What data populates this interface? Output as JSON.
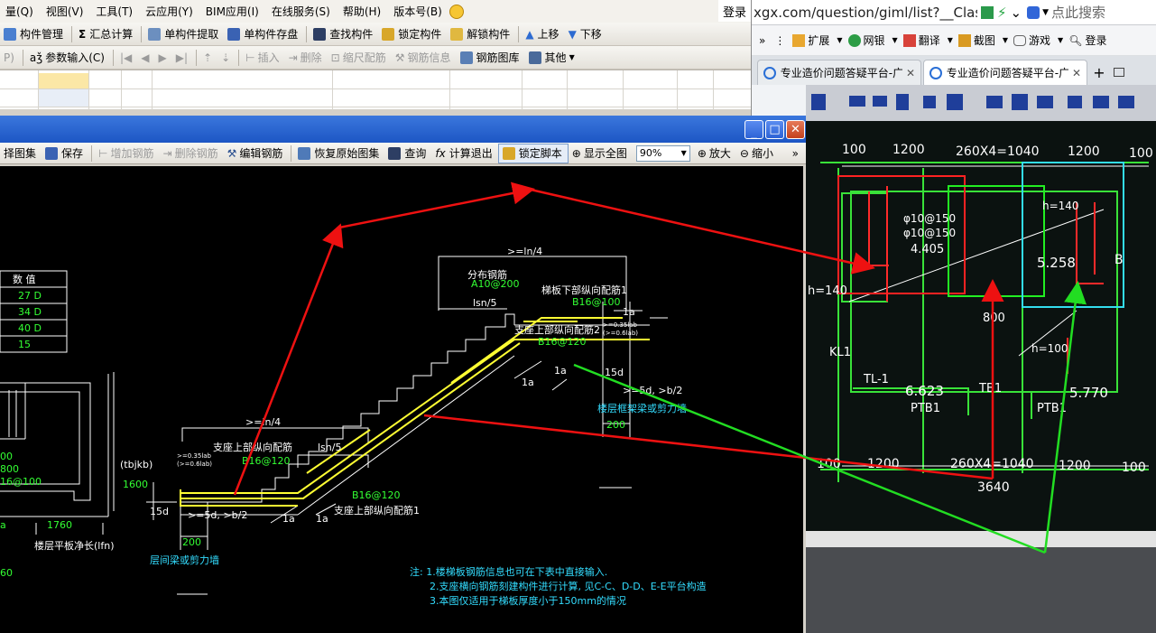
{
  "menu": {
    "items": [
      "量(Q)",
      "视图(V)",
      "工具(T)",
      "云应用(Y)",
      "BIM应用(I)",
      "在线服务(S)",
      "帮助(H)",
      "版本号(B)"
    ],
    "login": "登录"
  },
  "toolbar1": {
    "items": [
      "构件管理",
      "汇总计算",
      "单构件提取",
      "单构件存盘",
      "查找构件",
      "锁定构件",
      "解锁构件",
      "上移",
      "下移"
    ]
  },
  "toolbar2": {
    "prefix": "P)",
    "param_input": "参数输入(C)",
    "insert": "插入",
    "delete": "删除",
    "scale_rebar": "缩尺配筋",
    "rebar_info": "钢筋信息",
    "rebar_library": "钢筋图库",
    "other": "其他"
  },
  "dialog_toolbar": {
    "select_atlas": "择图集",
    "save": "保存",
    "add_rebar": "增加钢筋",
    "delete_rebar": "删除钢筋",
    "edit_rebar": "编辑钢筋",
    "restore_atlas": "恢复原始图集",
    "query": "查询",
    "calc_exit": "计算退出",
    "lock_script": "锁定脚本",
    "show_all": "显示全图",
    "zoom_value": "90%",
    "zoom_in": "放大",
    "zoom_out": "缩小"
  },
  "cad": {
    "table_header": "数 值",
    "table_rows": [
      "27 D",
      "34 D",
      "40 D",
      "15"
    ],
    "left_values": [
      "00",
      "800",
      "16@100"
    ],
    "dim_1760": "1760",
    "dim_a": "a",
    "dim_60": "60",
    "net_length_label": "楼层平板净长(lfn)",
    "tbjkb": "(tbjkb)",
    "dim_1600": "1600",
    "dim_15d_left": "15d",
    "dim_200_left": "200",
    "beam_wall_left": "层间梁或剪力墙",
    "dim_5d_left": ">=5d, >b/2",
    "la_1": "1a",
    "la_2": "1a",
    "support_top_rebar": "支座上部纵向配筋",
    "b16_120_a": "B16@120",
    "ln4_left": ">=ln/4",
    "lsn5_left": "lsn/5",
    "lab_left_1": ">=0.35lab",
    "lab_left_2": "(>=0.6lab)",
    "b16_120_b": "B16@120",
    "support_top_rebar_1": "支座上部纵向配筋1",
    "ln4_right": ">=ln/4",
    "distribution_rebar": "分布钢筋",
    "a10_200": "A10@200",
    "lsn5_right": "lsn/5",
    "bottom_rebar_1": "梯板下部纵向配筋1",
    "b16_100": "B16@100",
    "support_top_rebar_2": "支座上部纵向配筋2",
    "b16_120_c": "B16@120",
    "la_top": "1a",
    "lab_right_1": ">=0.35lab",
    "lab_right_2": "(>=0.6lab)",
    "la_3": "1a",
    "la_4": "1a",
    "dim_15d_right": "15d",
    "dim_5d_right": ">=5d, >b/2",
    "beam_wall_right": "楼层框架梁或剪力墙",
    "dim_200_right": "200",
    "notes": [
      "注: 1.楼梯板钢筋信息也可在下表中直接输入.",
      "2.支座横向钢筋刻建构件进行计算, 见C-C、D-D、E-E平台构造",
      "3.本图仅适用于梯板厚度小于150mm的情况"
    ]
  },
  "browser": {
    "url": "xgx.com/question/giml/list?__ClassCode",
    "search_placeholder": "点此搜索",
    "tools": [
      "扩展",
      "网银",
      "翻译",
      "截图",
      "游戏",
      "登录"
    ],
    "tabs": [
      "专业造价问题答疑平台-广",
      "专业造价问题答疑平台-广"
    ]
  },
  "photo": {
    "dims_top": [
      "100",
      "1200",
      "260X4=1040",
      "1200",
      "100"
    ],
    "dims_bottom": [
      "100",
      "1200",
      "260X4=1040",
      "1200",
      "100"
    ],
    "total": "3640",
    "rebar_a": "φ10@150",
    "rebar_b": "φ10@150",
    "elev_4405": "4.405",
    "elev_5258": "5.258",
    "elev_6623": "6.623",
    "elev_5770": "5.770",
    "h140": "h=140",
    "h140_b": "h=140",
    "h100": "h=100",
    "kl1": "KL1",
    "tl1": "TL-1",
    "ptb1_a": "PTB1",
    "ptb1_b": "PTB1",
    "tb1": "TB1",
    "dim_800": "800",
    "label_b": "B"
  },
  "colors": {
    "cad_bg": "#000000",
    "rebar_yellow": "#ffff33",
    "cad_green": "#33ff33",
    "cad_cyan": "#33ddff",
    "arrow_red": "#ee1111",
    "arrow_green": "#22dd22",
    "title_blue": "#2359c9"
  }
}
